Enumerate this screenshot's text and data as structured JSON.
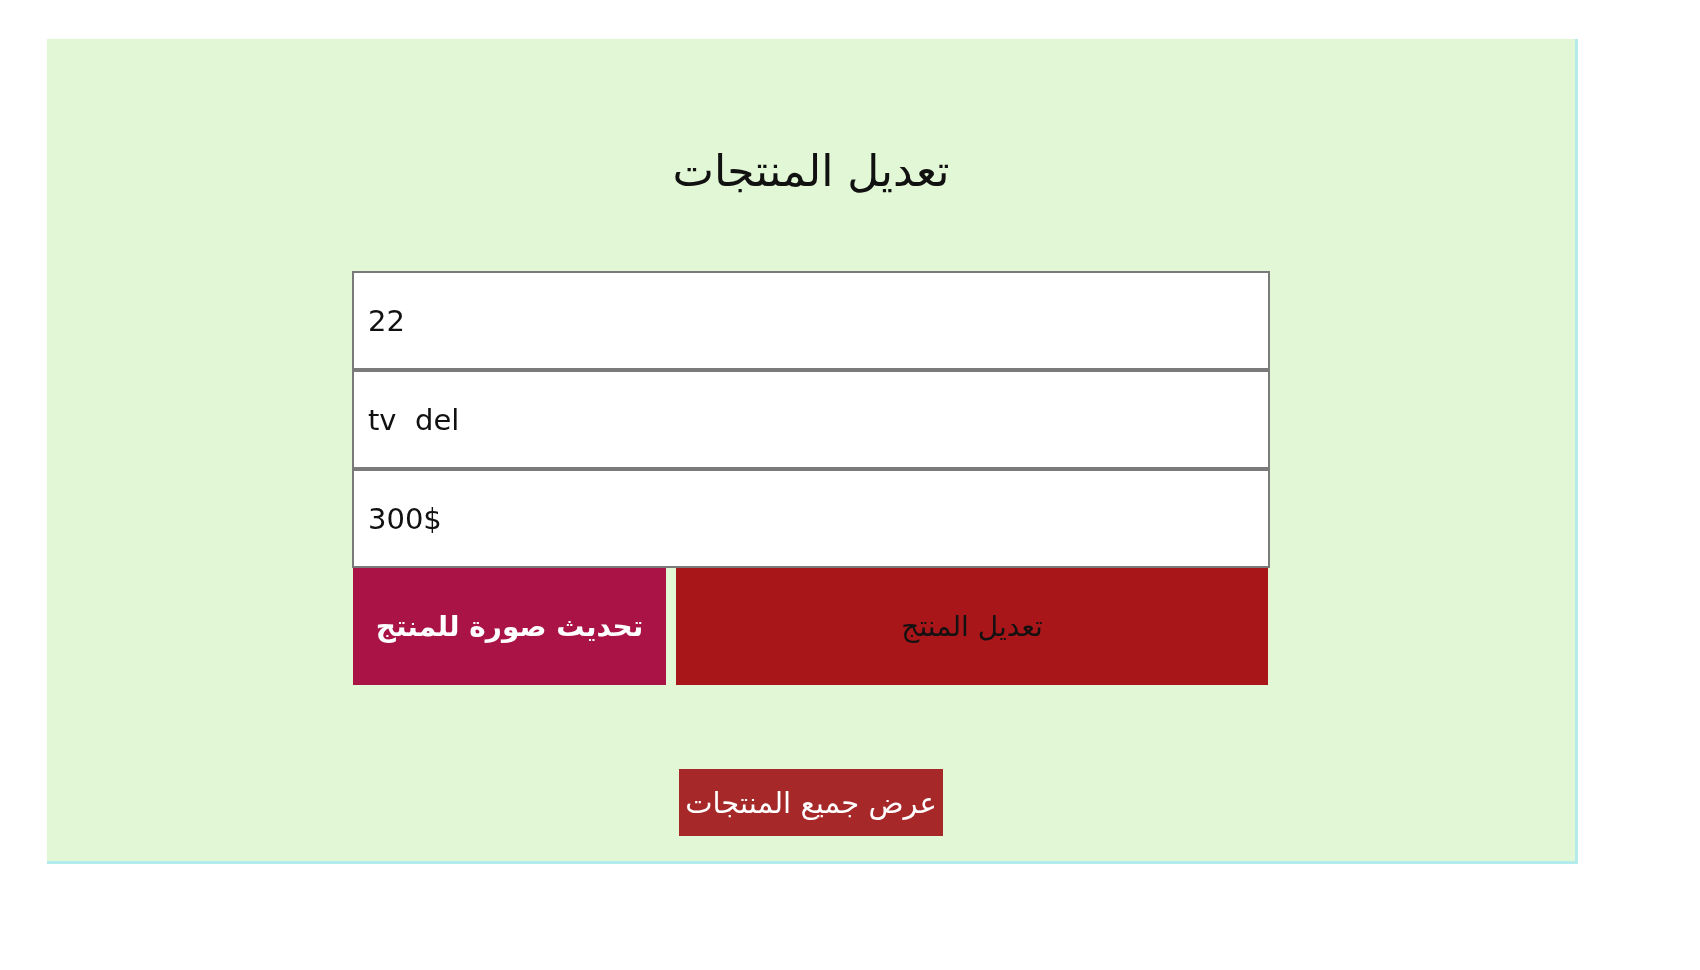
{
  "panel": {
    "title": "تعديل المنتجات"
  },
  "form": {
    "fields": [
      {
        "value": "22"
      },
      {
        "value": "tv  del"
      },
      {
        "value": "300$"
      }
    ],
    "buttons": [
      {
        "label": "تعديل المنتج",
        "kind": "submit",
        "color": "#a8161a"
      },
      {
        "label": "تحديث صورة للمنتج",
        "kind": "upload",
        "color": "#a91346"
      }
    ]
  },
  "footer_link": {
    "label": "عرض جميع المنتجات",
    "color": "#a62828"
  }
}
